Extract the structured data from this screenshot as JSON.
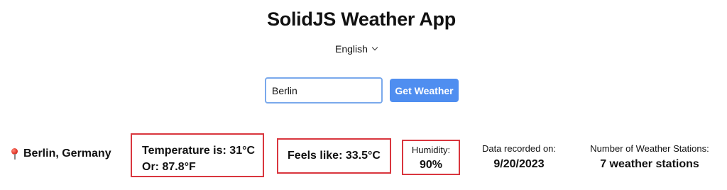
{
  "app": {
    "title": "SolidJS Weather App"
  },
  "language": {
    "selected": "English",
    "icon": "chevron-down-icon"
  },
  "search": {
    "value": "Berlin",
    "button_label": "Get Weather",
    "button_color": "#4f8ef0",
    "input_border_color": "#7aa9ec"
  },
  "weather": {
    "location": "Berlin, Germany",
    "location_icon": "map-pin-icon",
    "temperature_line": "Temperature is: 31°C",
    "temperature_alt_line": "Or: 87.8°F",
    "feels_like": "Feels like: 33.5°C",
    "humidity_label": "Humidity:",
    "humidity_value": "90%",
    "recorded_label": "Data recorded on:",
    "recorded_value": "9/20/2023",
    "stations_label": "Number of Weather Stations:",
    "stations_value": "7 weather stations",
    "highlight_color": "#d9363e"
  }
}
